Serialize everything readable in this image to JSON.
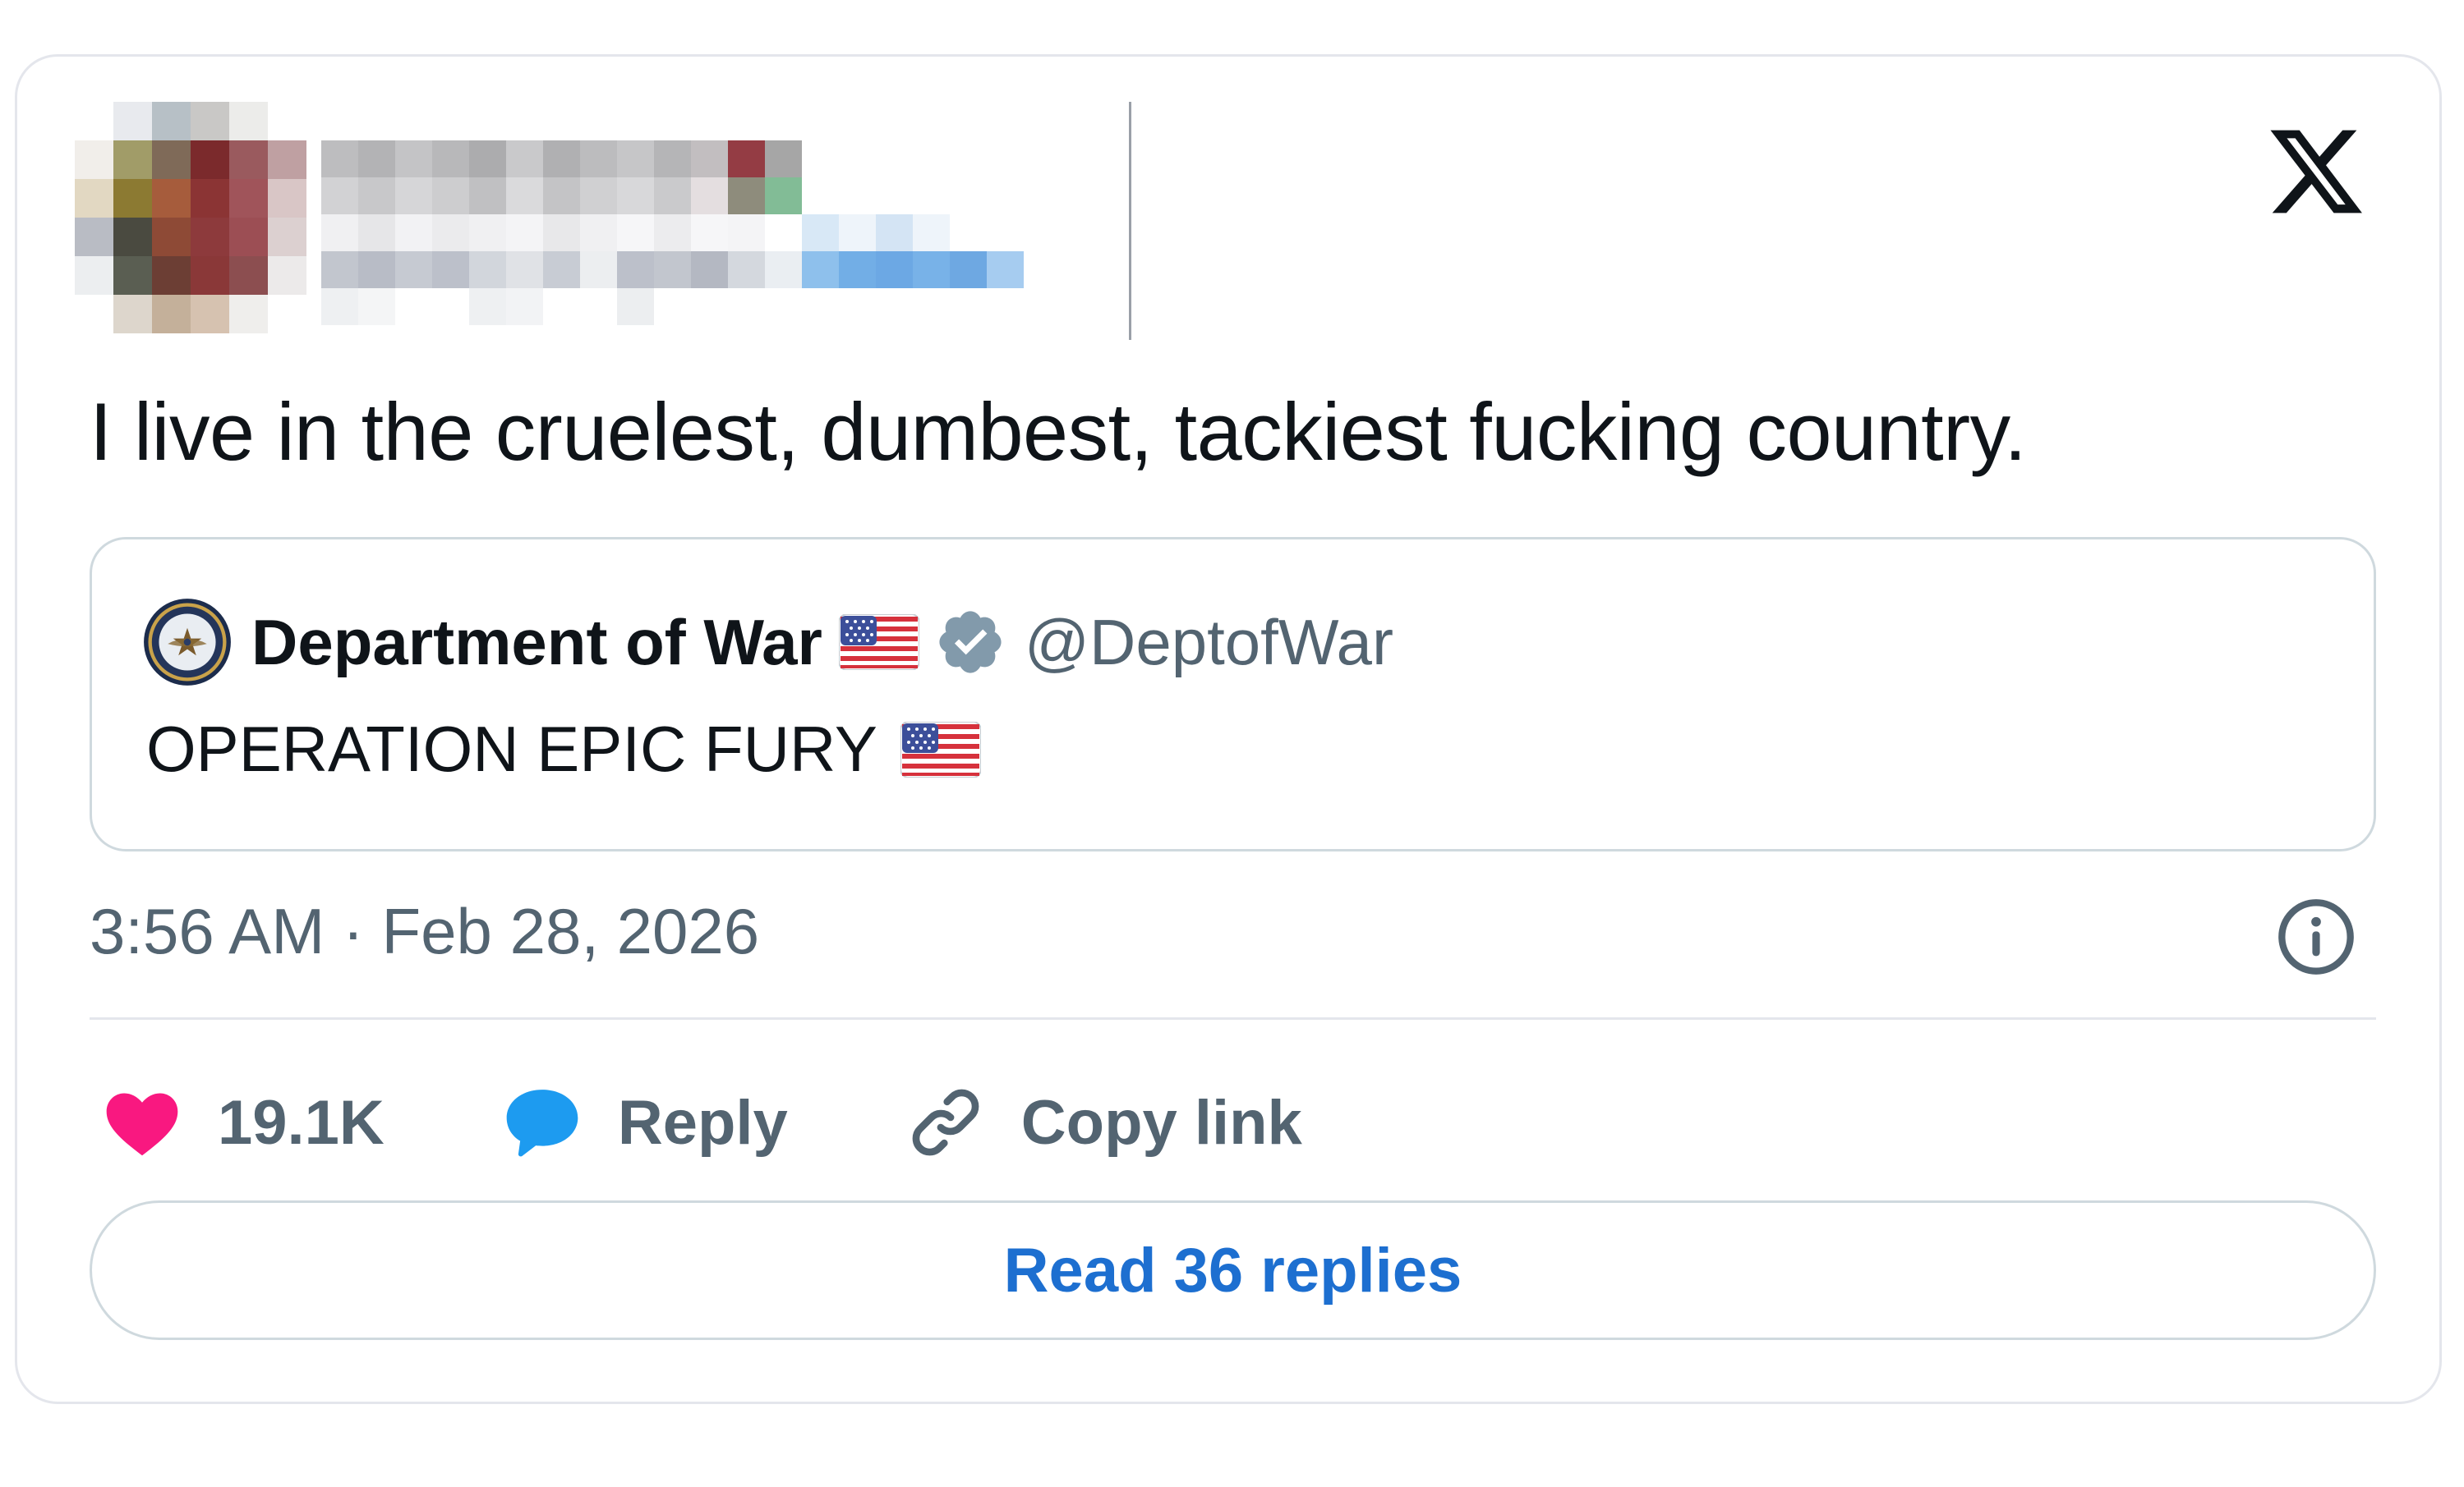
{
  "tweet": {
    "text": "I live in the cruelest, dumbest, tackiest fucking country.",
    "timestamp": "3:56 AM · Feb 28, 2026"
  },
  "quoted": {
    "name": "Department of War",
    "handle": "@DeptofWar",
    "text": "OPERATION EPIC FURY",
    "emoji": "us-flag",
    "verified": true
  },
  "actions": {
    "likes": "19.1K",
    "reply_label": "Reply",
    "copy_label": "Copy link"
  },
  "read_replies_label": "Read 36 replies",
  "colors": {
    "accent": "#1d6fd0",
    "like": "#f91880",
    "reply": "#1d9bf0",
    "muted": "#536471",
    "text": "#0f1419"
  },
  "icons": [
    "x-logo-icon",
    "verified-badge-icon",
    "us-flag-icon",
    "info-icon",
    "heart-icon",
    "reply-bubble-icon",
    "link-icon"
  ]
}
